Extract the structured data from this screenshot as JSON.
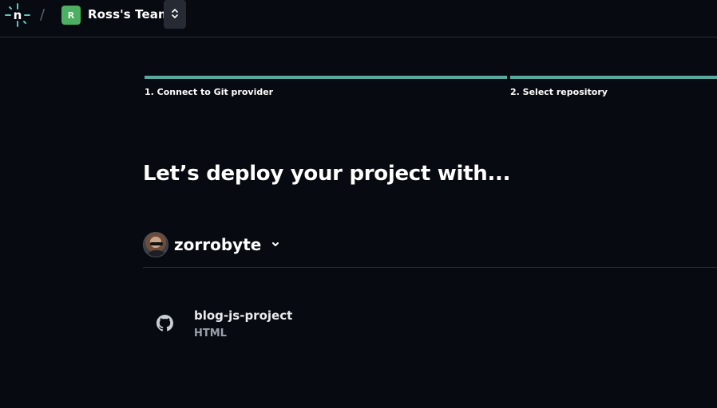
{
  "colors": {
    "background": "#070a10",
    "accent_step": "#5aa8a0",
    "team_avatar": "#4caf62",
    "divider": "#2a2f37",
    "muted_text": "#9aa1ab"
  },
  "header": {
    "logo_icon": "netlify-logo-icon",
    "separator": "/",
    "team_initial": "R",
    "team_name": "Ross's Team",
    "team_switch_icon": "chevron-up-down-icon"
  },
  "steps": [
    {
      "label": "1. Connect to Git provider"
    },
    {
      "label": "2. Select repository"
    }
  ],
  "main": {
    "heading": "Let’s deploy your project with...",
    "account": {
      "username": "zorrobyte",
      "dropdown_icon": "chevron-down-icon"
    },
    "repositories": [
      {
        "name": "blog-js-project",
        "language": "HTML",
        "icon": "github-icon"
      }
    ]
  }
}
